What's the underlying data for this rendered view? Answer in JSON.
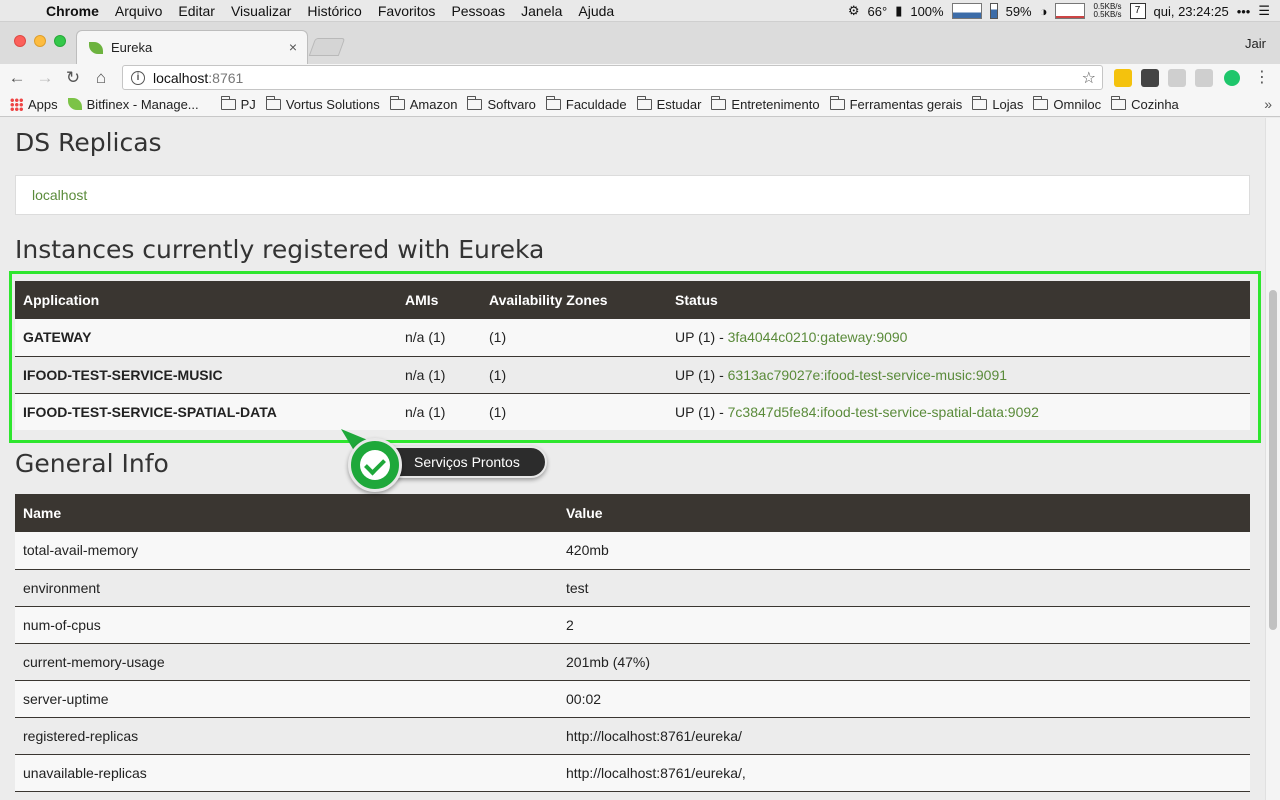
{
  "menubar": {
    "app_name": "Chrome",
    "menus": [
      "Arquivo",
      "Editar",
      "Visualizar",
      "Histórico",
      "Favoritos",
      "Pessoas",
      "Janela",
      "Ajuda"
    ],
    "temperature": "66°",
    "battery": "100%",
    "memory": "59%",
    "net_up": "0.5KB/s",
    "net_down": "0.5KB/s",
    "calendar_day": "7",
    "clock": "qui, 23:24:25",
    "dots": "•••"
  },
  "tab": {
    "title": "Eureka",
    "close": "×"
  },
  "profile": {
    "name": "Jair"
  },
  "omnibox": {
    "host": "localhost",
    "port": ":8761"
  },
  "bookmarks": {
    "apps_label": "Apps",
    "items": [
      "Bitfinex - Manage...",
      "PJ",
      "Vortus Solutions",
      "Amazon",
      "Softvaro",
      "Faculdade",
      "Estudar",
      "Entretenimento",
      "Ferramentas gerais",
      "Lojas",
      "Omniloc",
      "Cozinha"
    ],
    "more": "»"
  },
  "page": {
    "ds_replicas_title": "DS Replicas",
    "ds_replica_link": "localhost",
    "instances_title": "Instances currently registered with Eureka",
    "instances_headers": [
      "Application",
      "AMIs",
      "Availability Zones",
      "Status"
    ],
    "instances": [
      {
        "app": "GATEWAY",
        "amis": "n/a (1)",
        "zones": "(1)",
        "status_prefix": "UP (1) - ",
        "status_link": "3fa4044c0210:gateway:9090"
      },
      {
        "app": "IFOOD-TEST-SERVICE-MUSIC",
        "amis": "n/a (1)",
        "zones": "(1)",
        "status_prefix": "UP (1) - ",
        "status_link": "6313ac79027e:ifood-test-service-music:9091"
      },
      {
        "app": "IFOOD-TEST-SERVICE-SPATIAL-DATA",
        "amis": "n/a (1)",
        "zones": "(1)",
        "status_prefix": "UP (1) - ",
        "status_link": "7c3847d5fe84:ifood-test-service-spatial-data:9092"
      }
    ],
    "general_title": "General Info",
    "general_headers": [
      "Name",
      "Value"
    ],
    "general_rows": [
      {
        "name": "total-avail-memory",
        "value": "420mb"
      },
      {
        "name": "environment",
        "value": "test"
      },
      {
        "name": "num-of-cpus",
        "value": "2"
      },
      {
        "name": "current-memory-usage",
        "value": "201mb (47%)"
      },
      {
        "name": "server-uptime",
        "value": "00:02"
      },
      {
        "name": "registered-replicas",
        "value": "http://localhost:8761/eureka/"
      },
      {
        "name": "unavailable-replicas",
        "value": "http://localhost:8761/eureka/,"
      }
    ]
  },
  "annotation": {
    "label": "Serviços Prontos",
    "accent": "#2ee62e"
  },
  "colors": {
    "link": "#5a8b3a",
    "table_header": "#3a3631"
  }
}
